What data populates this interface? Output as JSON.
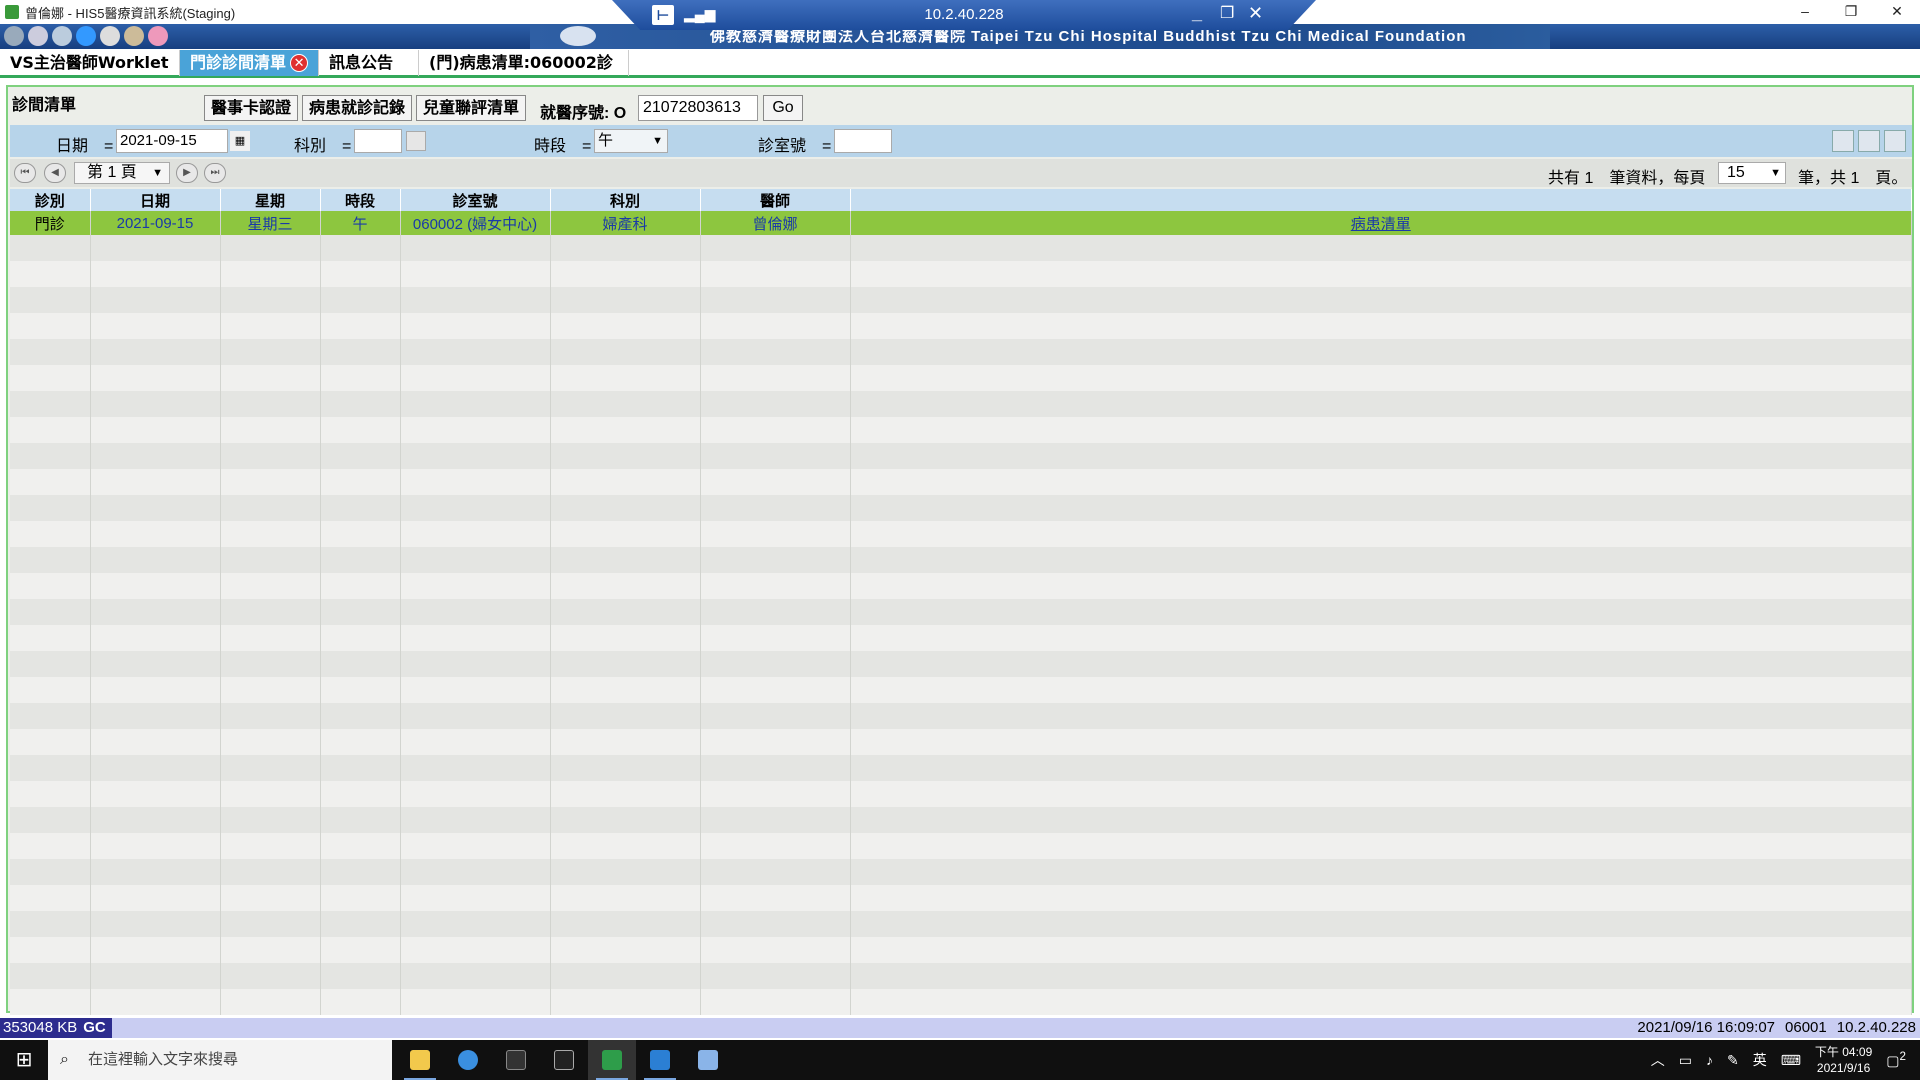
{
  "window": {
    "title": "曾倫娜 - HIS5醫療資訊系統(Staging)",
    "controls": [
      "–",
      "❐",
      "✕"
    ]
  },
  "rdp": {
    "ip": "10.2.40.228",
    "min": "_",
    "restore": "❐",
    "close": "✕"
  },
  "banner": {
    "text": "佛教慈濟醫療財團法人台北慈濟醫院 Taipei Tzu Chi Hospital Buddhist Tzu Chi Medical Foundation"
  },
  "tabs": [
    {
      "label": "VS主治醫師Worklet"
    },
    {
      "label": "門診診間清單"
    },
    {
      "label": "訊息公告"
    },
    {
      "label": "(門)病患清單:060002診"
    }
  ],
  "panel": {
    "title": "診間清單",
    "buttons": {
      "card_auth": "醫事卡認證",
      "visit_record": "病患就診記錄",
      "child_eval": "兒童聯評清單"
    },
    "visit_no_label": "就醫序號: O",
    "visit_no_value": "21072803613",
    "go": "Go"
  },
  "filter": {
    "date_label": "日期　=",
    "date_value": "2021-09-15",
    "dept_label": "科別　=",
    "dept_value": "",
    "period_label": "時段　=",
    "period_value": "午",
    "room_label": "診室號　=",
    "room_value": ""
  },
  "pager": {
    "page": "第 1 頁",
    "total_prefix": "共有 1　筆資料，每頁",
    "per_page": "15",
    "total_suffix": "筆，共 1　頁。"
  },
  "table": {
    "headers": [
      "診別",
      "日期",
      "星期",
      "時段",
      "診室號",
      "科別",
      "醫師",
      ""
    ],
    "rows": [
      [
        "門診",
        "2021-09-15",
        "星期三",
        "午",
        "060002 (婦女中心)",
        "婦產科",
        "曾倫娜",
        "病患清單"
      ]
    ]
  },
  "status": {
    "memory": "353048 KB",
    "gc": "GC",
    "datetime": "2021/09/16 16:09:07",
    "code": "06001",
    "ip": "10.2.40.228"
  },
  "taskbar": {
    "search_placeholder": "在這裡輸入文字來搜尋",
    "ime": "英",
    "time": "下午 04:09",
    "date": "2021/9/16",
    "notif_count": "2"
  }
}
